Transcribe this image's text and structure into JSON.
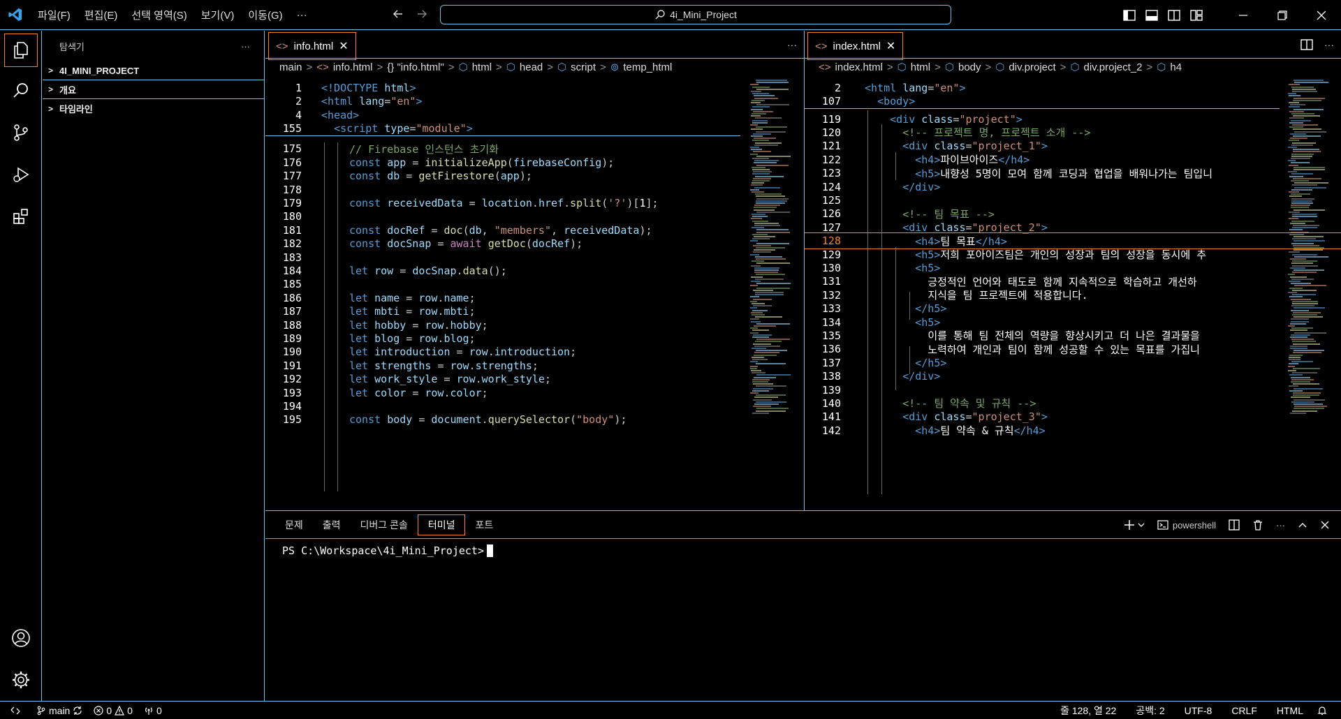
{
  "titlebar": {
    "menu": [
      "파일(F)",
      "편집(E)",
      "선택 영역(S)",
      "보기(V)",
      "이동(G)",
      "···"
    ],
    "search_text": "4i_Mini_Project"
  },
  "sidebar": {
    "title": "탐색기",
    "more": "···",
    "sections": [
      "4I_MINI_PROJECT",
      "개요",
      "타임라인"
    ]
  },
  "editor_left": {
    "tab": "info.html",
    "more": "···",
    "breadcrumb": [
      "main",
      "info.html",
      "{} \"info.html\"",
      "html",
      "head",
      "script",
      "temp_html"
    ],
    "sticky": [
      {
        "ln": "1",
        "html": "<span class='c-tag'>&lt;!DOCTYPE</span> <span class='c-attr'>html</span><span class='c-tag'>&gt;</span>"
      },
      {
        "ln": "2",
        "html": "<span class='c-tag'>&lt;html</span> <span class='c-attr'>lang</span><span class='c-pun'>=</span><span class='c-str'>\"en\"</span><span class='c-tag'>&gt;</span>"
      },
      {
        "ln": "4",
        "html": "<span class='c-tag'>&lt;head&gt;</span>"
      },
      {
        "ln": "155",
        "html": "  <span class='c-tag'>&lt;script</span> <span class='c-attr'>type</span><span class='c-pun'>=</span><span class='c-str'>\"module\"</span><span class='c-tag'>&gt;</span>"
      }
    ],
    "lines": [
      {
        "ln": "175",
        "html": "<span class='c-cmt'>// Firebase 인스턴스 초기화</span>"
      },
      {
        "ln": "176",
        "html": "<span class='c-kw'>const</span> <span class='c-var'>app</span> <span class='c-pun'>=</span> <span class='c-fn'>initializeApp</span><span class='c-pun'>(</span><span class='c-var'>firebaseConfig</span><span class='c-pun'>);</span>"
      },
      {
        "ln": "177",
        "html": "<span class='c-kw'>const</span> <span class='c-var'>db</span> <span class='c-pun'>=</span> <span class='c-fn'>getFirestore</span><span class='c-pun'>(</span><span class='c-var'>app</span><span class='c-pun'>);</span>"
      },
      {
        "ln": "178",
        "html": ""
      },
      {
        "ln": "179",
        "html": "<span class='c-kw'>const</span> <span class='c-var'>receivedData</span> <span class='c-pun'>=</span> <span class='c-var'>location</span><span class='c-pun'>.</span><span class='c-var'>href</span><span class='c-pun'>.</span><span class='c-fn'>split</span><span class='c-pun'>(</span><span class='c-str'>'?'</span><span class='c-pun'>)[</span><span class='c-txt'>1</span><span class='c-pun'>];</span>"
      },
      {
        "ln": "180",
        "html": ""
      },
      {
        "ln": "181",
        "html": "<span class='c-kw'>const</span> <span class='c-var'>docRef</span> <span class='c-pun'>=</span> <span class='c-fn'>doc</span><span class='c-pun'>(</span><span class='c-var'>db</span><span class='c-pun'>,</span> <span class='c-str'>\"members\"</span><span class='c-pun'>,</span> <span class='c-var'>receivedData</span><span class='c-pun'>);</span>"
      },
      {
        "ln": "182",
        "html": "<span class='c-kw'>const</span> <span class='c-var'>docSnap</span> <span class='c-pun'>=</span> <span class='c-kw2'>await</span> <span class='c-fn'>getDoc</span><span class='c-pun'>(</span><span class='c-var'>docRef</span><span class='c-pun'>);</span>"
      },
      {
        "ln": "183",
        "html": ""
      },
      {
        "ln": "184",
        "html": "<span class='c-kw'>let</span> <span class='c-var'>row</span> <span class='c-pun'>=</span> <span class='c-var'>docSnap</span><span class='c-pun'>.</span><span class='c-fn'>data</span><span class='c-pun'>();</span>"
      },
      {
        "ln": "185",
        "html": ""
      },
      {
        "ln": "186",
        "html": "<span class='c-kw'>let</span> <span class='c-var'>name</span> <span class='c-pun'>=</span> <span class='c-var'>row</span><span class='c-pun'>.</span><span class='c-var'>name</span><span class='c-pun'>;</span>"
      },
      {
        "ln": "187",
        "html": "<span class='c-kw'>let</span> <span class='c-var'>mbti</span> <span class='c-pun'>=</span> <span class='c-var'>row</span><span class='c-pun'>.</span><span class='c-var'>mbti</span><span class='c-pun'>;</span>"
      },
      {
        "ln": "188",
        "html": "<span class='c-kw'>let</span> <span class='c-var'>hobby</span> <span class='c-pun'>=</span> <span class='c-var'>row</span><span class='c-pun'>.</span><span class='c-var'>hobby</span><span class='c-pun'>;</span>"
      },
      {
        "ln": "189",
        "html": "<span class='c-kw'>let</span> <span class='c-var'>blog</span> <span class='c-pun'>=</span> <span class='c-var'>row</span><span class='c-pun'>.</span><span class='c-var'>blog</span><span class='c-pun'>;</span>"
      },
      {
        "ln": "190",
        "html": "<span class='c-kw'>let</span> <span class='c-var'>introduction</span> <span class='c-pun'>=</span> <span class='c-var'>row</span><span class='c-pun'>.</span><span class='c-var'>introduction</span><span class='c-pun'>;</span>"
      },
      {
        "ln": "191",
        "html": "<span class='c-kw'>let</span> <span class='c-var'>strengths</span> <span class='c-pun'>=</span> <span class='c-var'>row</span><span class='c-pun'>.</span><span class='c-var'>strengths</span><span class='c-pun'>;</span>"
      },
      {
        "ln": "192",
        "html": "<span class='c-kw'>let</span> <span class='c-var'>work_style</span> <span class='c-pun'>=</span> <span class='c-var'>row</span><span class='c-pun'>.</span><span class='c-var'>work_style</span><span class='c-pun'>;</span>"
      },
      {
        "ln": "193",
        "html": "<span class='c-kw'>let</span> <span class='c-var'>color</span> <span class='c-pun'>=</span> <span class='c-var'>row</span><span class='c-pun'>.</span><span class='c-var'>color</span><span class='c-pun'>;</span>"
      },
      {
        "ln": "194",
        "html": ""
      },
      {
        "ln": "195",
        "html": "<span class='c-kw'>const</span> <span class='c-var'>body</span> <span class='c-pun'>=</span> <span class='c-var'>document</span><span class='c-pun'>.</span><span class='c-fn'>querySelector</span><span class='c-pun'>(</span><span class='c-str'>\"body\"</span><span class='c-pun'>);</span>"
      }
    ]
  },
  "editor_right": {
    "tab": "index.html",
    "breadcrumb": [
      "index.html",
      "html",
      "body",
      "div.project",
      "div.project_2",
      "h4"
    ],
    "sticky": [
      {
        "ln": "2",
        "html": "<span class='c-tag'>&lt;html</span> <span class='c-attr'>lang</span><span class='c-pun'>=</span><span class='c-str'>\"en\"</span><span class='c-tag'>&gt;</span>"
      },
      {
        "ln": "107",
        "html": "  <span class='c-tag'>&lt;body&gt;</span>"
      }
    ],
    "lines": [
      {
        "ln": "119",
        "html": "    <span class='c-tag'>&lt;div</span> <span class='c-attr'>class</span><span class='c-pun'>=</span><span class='c-str'>\"project\"</span><span class='c-tag'>&gt;</span>"
      },
      {
        "ln": "120",
        "html": "      <span class='c-cmt'>&lt;!-- 프로젝트 명, 프로젝트 소개 --&gt;</span>"
      },
      {
        "ln": "121",
        "html": "      <span class='c-tag'>&lt;div</span> <span class='c-attr'>class</span><span class='c-pun'>=</span><span class='c-str'>\"project_1\"</span><span class='c-tag'>&gt;</span>"
      },
      {
        "ln": "122",
        "html": "        <span class='c-tag'>&lt;h4&gt;</span><span class='c-txt'>파이브아이즈</span><span class='c-tag'>&lt;/h4&gt;</span>"
      },
      {
        "ln": "123",
        "html": "        <span class='c-tag'>&lt;h5&gt;</span><span class='c-txt'>내향성 5명이 모여 함께 코딩과 협업을 배워나가는 팀입니</span>"
      },
      {
        "ln": "124",
        "html": "      <span class='c-tag'>&lt;/div&gt;</span>"
      },
      {
        "ln": "125",
        "html": ""
      },
      {
        "ln": "126",
        "html": "      <span class='c-cmt'>&lt;!-- 팀 목표 --&gt;</span>"
      },
      {
        "ln": "127",
        "html": "      <span class='c-tag'>&lt;div</span> <span class='c-attr'>class</span><span class='c-pun'>=</span><span class='c-str'>\"project_2\"</span><span class='c-tag'>&gt;</span>"
      },
      {
        "ln": "128",
        "html": "        <span class='c-tag'>&lt;h4&gt;</span><span class='c-txt'>팀 목표</span><span class='c-tag'>&lt;/h4&gt;</span>"
      },
      {
        "ln": "129",
        "html": "        <span class='c-tag'>&lt;h5&gt;</span><span class='c-txt'>저희 포아이즈팀은 개인의 성장과 팀의 성장을 동시에 추</span>"
      },
      {
        "ln": "130",
        "html": "        <span class='c-tag'>&lt;h5&gt;</span>"
      },
      {
        "ln": "131",
        "html": "          <span class='c-txt'>긍정적인 언어와 태도로 함께 지속적으로 학습하고 개선하</span>"
      },
      {
        "ln": "132",
        "html": "          <span class='c-txt'>지식을 팀 프로젝트에 적용합니다.</span>"
      },
      {
        "ln": "133",
        "html": "        <span class='c-tag'>&lt;/h5&gt;</span>"
      },
      {
        "ln": "134",
        "html": "        <span class='c-tag'>&lt;h5&gt;</span>"
      },
      {
        "ln": "135",
        "html": "          <span class='c-txt'>이를 통해 팀 전체의 역량을 향상시키고 더 나은 결과물을</span>"
      },
      {
        "ln": "136",
        "html": "          <span class='c-txt'>노력하여 개인과 팀이 함께 성공할 수 있는 목표를 가집니</span>"
      },
      {
        "ln": "137",
        "html": "        <span class='c-tag'>&lt;/h5&gt;</span>"
      },
      {
        "ln": "138",
        "html": "      <span class='c-tag'>&lt;/div&gt;</span>"
      },
      {
        "ln": "139",
        "html": ""
      },
      {
        "ln": "140",
        "html": "      <span class='c-cmt'>&lt;!-- 팀 약속 및 규칙 --&gt;</span>"
      },
      {
        "ln": "141",
        "html": "      <span class='c-tag'>&lt;div</span> <span class='c-attr'>class</span><span class='c-pun'>=</span><span class='c-str'>\"project_3\"</span><span class='c-tag'>&gt;</span>"
      },
      {
        "ln": "142",
        "html": "        <span class='c-tag'>&lt;h4&gt;</span><span class='c-txt'>팀 약속 &amp; 규칙</span><span class='c-tag'>&lt;/h4&gt;</span>"
      }
    ]
  },
  "panel": {
    "tabs": [
      "문제",
      "출력",
      "디버그 콘솔",
      "터미널",
      "포트"
    ],
    "active_tab": "터미널",
    "shell": "powershell",
    "prompt": "PS C:\\Workspace\\4i_Mini_Project>"
  },
  "statusbar": {
    "branch": "main",
    "errors": "0",
    "warnings": "0",
    "ports": "0",
    "position": "줄 128, 열 22",
    "spaces": "공백: 2",
    "encoding": "UTF-8",
    "eol": "CRLF",
    "language": "HTML"
  },
  "colors": {
    "border": "#6fc3df",
    "active_border": "#f38518",
    "background": "#000000"
  }
}
